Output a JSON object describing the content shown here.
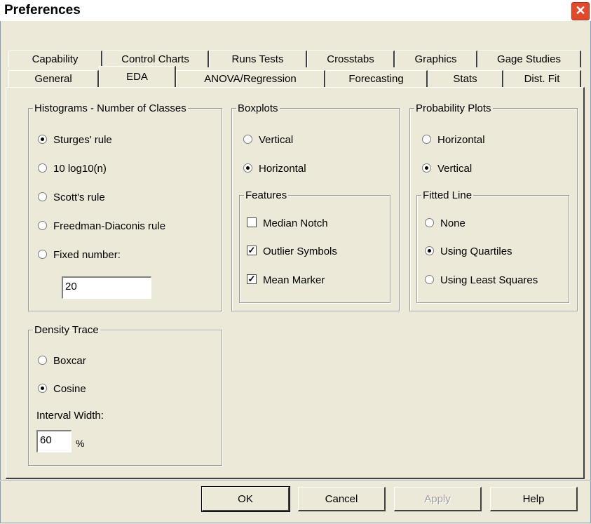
{
  "window": {
    "title": "Preferences",
    "close_symbol": "✕"
  },
  "tabs_row1": [
    "Capability",
    "Control Charts",
    "Runs Tests",
    "Crosstabs",
    "Graphics",
    "Gage Studies"
  ],
  "tabs_row2": [
    "General",
    "EDA",
    "ANOVA/Regression",
    "Forecasting",
    "Stats",
    "Dist. Fit"
  ],
  "active_tab": "EDA",
  "histograms": {
    "legend": "Histograms - Number of Classes",
    "options": [
      "Sturges' rule",
      "10 log10(n)",
      "Scott's rule",
      "Freedman-Diaconis rule",
      "Fixed number:"
    ],
    "selected": "Sturges' rule",
    "fixed_value": "20"
  },
  "boxplots": {
    "legend": "Boxplots",
    "options": [
      "Vertical",
      "Horizontal"
    ],
    "selected": "Horizontal",
    "features": {
      "legend": "Features",
      "items": [
        {
          "label": "Median Notch",
          "checked": false
        },
        {
          "label": "Outlier Symbols",
          "checked": true
        },
        {
          "label": "Mean Marker",
          "checked": true
        }
      ]
    }
  },
  "probability_plots": {
    "legend": "Probability Plots",
    "options": [
      "Horizontal",
      "Vertical"
    ],
    "selected": "Vertical",
    "fitted_line": {
      "legend": "Fitted Line",
      "options": [
        "None",
        "Using Quartiles",
        "Using Least Squares"
      ],
      "selected": "Using Quartiles"
    }
  },
  "density_trace": {
    "legend": "Density Trace",
    "options": [
      "Boxcar",
      "Cosine"
    ],
    "selected": "Cosine",
    "interval_label": "Interval Width:",
    "interval_value": "60",
    "interval_unit": "%"
  },
  "buttons": {
    "ok": "OK",
    "cancel": "Cancel",
    "apply": "Apply",
    "help": "Help"
  }
}
